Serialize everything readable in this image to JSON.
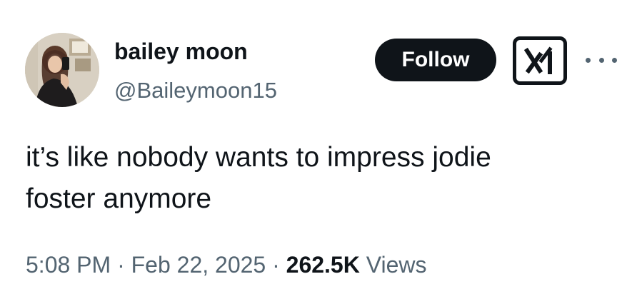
{
  "author": {
    "display_name": "bailey moon",
    "handle": "@Baileymoon15",
    "avatar_icon": "profile-photo"
  },
  "actions": {
    "follow_label": "Follow",
    "grok_icon": "grok-icon",
    "more_icon": "more-horizontal-icon"
  },
  "tweet": {
    "text_lines": [
      "it’s like nobody wants to impress jodie",
      "foster anymore"
    ]
  },
  "meta": {
    "time": "5:08 PM",
    "separator": "·",
    "date": "Feb 22, 2025",
    "views_count": "262.5K",
    "views_label": "Views"
  },
  "colors": {
    "text_primary": "#0f1419",
    "text_secondary": "#536471",
    "follow_bg": "#0f1419",
    "background": "#ffffff"
  }
}
